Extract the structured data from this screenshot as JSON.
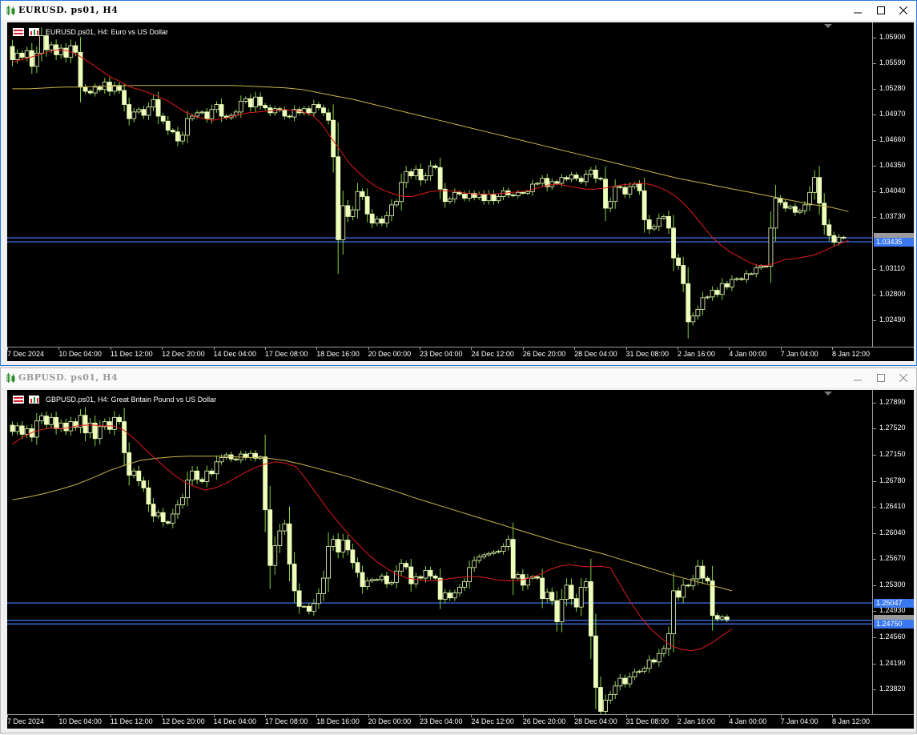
{
  "windows": [
    {
      "id": "eurusd",
      "title": "EURUSD. ps01, H4",
      "chart_label": "EURUSD.ps01, H4:  Euro vs US Dollar",
      "price_labels": [
        "1.05900",
        "1.05590",
        "1.05280",
        "1.04970",
        "1.04660",
        "1.04350",
        "1.04040",
        "1.03730",
        "1.03110",
        "1.02800",
        "1.02490"
      ],
      "price_values": [
        1.059,
        1.0559,
        1.0528,
        1.0497,
        1.0466,
        1.0435,
        1.0404,
        1.0373,
        1.0311,
        1.028,
        1.0249
      ],
      "y_range": [
        1.0217,
        1.0608
      ],
      "hlines": [
        1.03482,
        1.03435
      ],
      "badges": [
        {
          "text": "1.03435",
          "value": 1.03435
        }
      ],
      "time_labels": [
        "7 Dec 2024",
        "10 Dec 04:00",
        "11 Dec 12:00",
        "12 Dec 20:00",
        "14 Dec 04:00",
        "17 Dec 08:00",
        "18 Dec 16:00",
        "20 Dec 00:00",
        "23 Dec 04:00",
        "24 Dec 12:00",
        "26 Dec 20:00",
        "28 Dec 04:00",
        "31 Dec 08:00",
        "2 Jan 16:00",
        "4 Jan 00:00",
        "7 Jan 04:00",
        "8 Jan 12:00"
      ],
      "series": [
        1.0579,
        1.0563,
        1.0571,
        1.0566,
        1.0574,
        1.0555,
        1.0571,
        1.0592,
        1.0575,
        1.0581,
        1.0569,
        1.0577,
        1.0566,
        1.058,
        1.0572,
        1.053,
        1.0525,
        1.0523,
        1.053,
        1.0527,
        1.0536,
        1.0525,
        1.0532,
        1.0526,
        1.0509,
        1.0492,
        1.05,
        1.0503,
        1.0496,
        1.0506,
        1.0515,
        1.0495,
        1.0489,
        1.0478,
        1.0476,
        1.0465,
        1.0472,
        1.0492,
        1.0495,
        1.0499,
        1.05,
        1.0492,
        1.0503,
        1.0509,
        1.0495,
        1.0493,
        1.0496,
        1.05,
        1.0513,
        1.0516,
        1.0506,
        1.0518,
        1.0508,
        1.0505,
        1.0499,
        1.0504,
        1.0502,
        1.0495,
        1.0494,
        1.0503,
        1.0499,
        1.0504,
        1.0499,
        1.0509,
        1.0505,
        1.0499,
        1.049,
        1.0446,
        1.0346,
        1.0387,
        1.0374,
        1.0382,
        1.0404,
        1.0398,
        1.0377,
        1.0366,
        1.0371,
        1.0366,
        1.0375,
        1.0388,
        1.0392,
        1.0415,
        1.0428,
        1.0423,
        1.0431,
        1.0418,
        1.0423,
        1.0435,
        1.0433,
        1.0407,
        1.0392,
        1.0395,
        1.0403,
        1.0401,
        1.0396,
        1.0402,
        1.0397,
        1.0401,
        1.0393,
        1.0401,
        1.0393,
        1.0398,
        1.0405,
        1.04,
        1.0399,
        1.0403,
        1.0402,
        1.0404,
        1.0413,
        1.0414,
        1.042,
        1.041,
        1.0416,
        1.0414,
        1.0421,
        1.0419,
        1.0424,
        1.042,
        1.0416,
        1.0425,
        1.043,
        1.042,
        1.0419,
        1.0384,
        1.0392,
        1.041,
        1.0409,
        1.0401,
        1.041,
        1.0413,
        1.0405,
        1.037,
        1.0359,
        1.0362,
        1.0372,
        1.0374,
        1.036,
        1.0324,
        1.0315,
        1.0293,
        1.0247,
        1.0254,
        1.0262,
        1.0276,
        1.0277,
        1.0285,
        1.028,
        1.0293,
        1.0289,
        1.0298,
        1.0299,
        1.0298,
        1.0305,
        1.0305,
        1.0312,
        1.0314,
        1.0314,
        1.036,
        1.0396,
        1.0391,
        1.0384,
        1.0386,
        1.0379,
        1.0381,
        1.0388,
        1.0403,
        1.0421,
        1.039,
        1.0364,
        1.0351,
        1.0343,
        1.0349,
        1.0348
      ],
      "ma_fast": [
        1.056,
        1.0563,
        1.0566,
        1.0569,
        1.0573,
        1.0575,
        1.0574,
        1.057,
        1.0563,
        1.0556,
        1.0548,
        1.0541,
        1.0536,
        1.053,
        1.0527,
        1.0523,
        1.0519,
        1.0514,
        1.0507,
        1.05,
        1.0495,
        1.0492,
        1.049,
        1.0492,
        1.0494,
        1.0497,
        1.0499,
        1.05,
        1.0501,
        1.0502,
        1.0503,
        1.0502,
        1.05,
        1.0496,
        1.0486,
        1.047,
        1.0455,
        1.0439,
        1.0428,
        1.0418,
        1.041,
        1.0405,
        1.0401,
        1.0398,
        1.0398,
        1.0401,
        1.0404,
        1.0405,
        1.0405,
        1.0404,
        1.0402,
        1.0401,
        1.0401,
        1.0401,
        1.0402,
        1.0403,
        1.0404,
        1.0406,
        1.0409,
        1.0412,
        1.0413,
        1.0411,
        1.0409,
        1.0407,
        1.0407,
        1.0408,
        1.041,
        1.0412,
        1.0413,
        1.0414,
        1.0413,
        1.041,
        1.0405,
        1.0398,
        1.0388,
        1.0376,
        1.0362,
        1.0349,
        1.0339,
        1.0331,
        1.0325,
        1.0319,
        1.0315,
        1.0315,
        1.0318,
        1.0322,
        1.0323,
        1.0325,
        1.0327,
        1.0331,
        1.0336,
        1.0341,
        1.0345
      ],
      "ma_slow": [
        1.0528,
        1.0528,
        1.0529,
        1.053,
        1.053,
        1.0531,
        1.0531,
        1.0532,
        1.0532,
        1.0532,
        1.0532,
        1.0532,
        1.0532,
        1.0532,
        1.0531,
        1.053,
        1.0529,
        1.0527,
        1.0523,
        1.0519,
        1.0515,
        1.051,
        1.0505,
        1.05,
        1.0495,
        1.049,
        1.0485,
        1.048,
        1.0475,
        1.047,
        1.0465,
        1.046,
        1.0455,
        1.045,
        1.0445,
        1.044,
        1.0435,
        1.043,
        1.0425,
        1.042,
        1.0416,
        1.0412,
        1.0408,
        1.0404,
        1.04,
        1.0396,
        1.0392,
        1.0388,
        1.0385,
        1.038
      ],
      "ma_slow_end": 1.038
    },
    {
      "id": "gbpusd",
      "title": "GBPUSD. ps01, H4",
      "chart_label": "GBPUSD.ps01, H4:  Great Britain Pound vs US Dollar",
      "price_labels": [
        "1.27890",
        "1.27520",
        "1.27150",
        "1.26780",
        "1.26410",
        "1.26040",
        "1.25670",
        "1.25300",
        "1.24930",
        "1.24560",
        "1.24190",
        "1.23820"
      ],
      "price_values": [
        1.2789,
        1.2752,
        1.2715,
        1.2678,
        1.2641,
        1.2604,
        1.2567,
        1.253,
        1.2493,
        1.2456,
        1.2419,
        1.2382
      ],
      "y_range": [
        1.2347,
        1.2807
      ],
      "hlines": [
        1.25047,
        1.248,
        1.2475
      ],
      "badges": [
        {
          "text": "1.25047",
          "value": 1.25047
        },
        {
          "text": "1.24750",
          "value": 1.2475
        }
      ],
      "time_labels": [
        "7 Dec 2024",
        "10 Dec 04:00",
        "11 Dec 12:00",
        "12 Dec 20:00",
        "14 Dec 04:00",
        "17 Dec 08:00",
        "18 Dec 16:00",
        "20 Dec 00:00",
        "23 Dec 04:00",
        "24 Dec 12:00",
        "26 Dec 20:00",
        "28 Dec 04:00",
        "31 Dec 08:00",
        "2 Jan 16:00",
        "4 Jan 00:00",
        "7 Jan 04:00",
        "8 Jan 12:00"
      ],
      "series": [
        1.2757,
        1.2748,
        1.2756,
        1.2744,
        1.2752,
        1.274,
        1.2763,
        1.277,
        1.2758,
        1.2768,
        1.2752,
        1.276,
        1.2749,
        1.2762,
        1.2754,
        1.2771,
        1.2746,
        1.276,
        1.2738,
        1.2755,
        1.2762,
        1.2751,
        1.2768,
        1.2762,
        1.2718,
        1.2686,
        1.2692,
        1.2678,
        1.2668,
        1.2645,
        1.2628,
        1.2633,
        1.262,
        1.2618,
        1.2631,
        1.2644,
        1.2654,
        1.2679,
        1.2692,
        1.268,
        1.2677,
        1.2692,
        1.2688,
        1.2705,
        1.2711,
        1.2715,
        1.2709,
        1.2708,
        1.2716,
        1.2711,
        1.2717,
        1.271,
        1.2712,
        1.2637,
        1.2558,
        1.2586,
        1.2607,
        1.2617,
        1.256,
        1.2522,
        1.25,
        1.25,
        1.2493,
        1.2504,
        1.2518,
        1.254,
        1.2585,
        1.2595,
        1.2577,
        1.2594,
        1.258,
        1.2562,
        1.2548,
        1.2528,
        1.2536,
        1.2538,
        1.2538,
        1.2543,
        1.2532,
        1.2534,
        1.255,
        1.2561,
        1.2556,
        1.2532,
        1.2542,
        1.254,
        1.2551,
        1.2543,
        1.254,
        1.251,
        1.2519,
        1.2512,
        1.2519,
        1.2527,
        1.2535,
        1.2555,
        1.2565,
        1.257,
        1.2573,
        1.2575,
        1.2577,
        1.2578,
        1.2585,
        1.2595,
        1.254,
        1.2545,
        1.253,
        1.254,
        1.2542,
        1.254,
        1.2511,
        1.252,
        1.2508,
        1.2478,
        1.251,
        1.253,
        1.2511,
        1.2499,
        1.2527,
        1.2535,
        1.2458,
        1.2385,
        1.2351,
        1.2367,
        1.2375,
        1.2387,
        1.2398,
        1.239,
        1.24,
        1.2407,
        1.2408,
        1.2412,
        1.2424,
        1.2421,
        1.2433,
        1.244,
        1.2461,
        1.2522,
        1.2513,
        1.253,
        1.2529,
        1.2539,
        1.2557,
        1.254,
        1.2536,
        1.2487,
        1.2482,
        1.2485,
        1.2481
      ],
      "ma_fast": [
        1.273,
        1.274,
        1.2747,
        1.2751,
        1.2753,
        1.2752,
        1.2755,
        1.2757,
        1.2757,
        1.2756,
        1.2756,
        1.275,
        1.2738,
        1.2724,
        1.2711,
        1.2698,
        1.2686,
        1.2676,
        1.267,
        1.2665,
        1.2668,
        1.2674,
        1.2682,
        1.269,
        1.2697,
        1.2702,
        1.2705,
        1.2703,
        1.2698,
        1.268,
        1.266,
        1.264,
        1.2622,
        1.2605,
        1.259,
        1.2575,
        1.2563,
        1.2553,
        1.2545,
        1.254,
        1.2538,
        1.2536,
        1.2537,
        1.2539,
        1.2541,
        1.2542,
        1.2542,
        1.254,
        1.2537,
        1.2536,
        1.2537,
        1.254,
        1.2545,
        1.2552,
        1.2557,
        1.2559,
        1.2557,
        1.2556,
        1.2557,
        1.2555,
        1.253,
        1.2506,
        1.2485,
        1.2468,
        1.2455,
        1.2444,
        1.2439,
        1.2437,
        1.244,
        1.2448,
        1.2458,
        1.2468
      ],
      "ma_slow": [
        1.2651,
        1.2655,
        1.266,
        1.2666,
        1.2673,
        1.2682,
        1.2692,
        1.27,
        1.2707,
        1.271,
        1.2712,
        1.2713,
        1.2713,
        1.2713,
        1.2712,
        1.2711,
        1.271,
        1.2707,
        1.2702,
        1.2696,
        1.269,
        1.2684,
        1.2677,
        1.267,
        1.2663,
        1.2655,
        1.2648,
        1.2641,
        1.2634,
        1.2627,
        1.262,
        1.2613,
        1.2606,
        1.2599,
        1.2592,
        1.2586,
        1.258,
        1.2574,
        1.2567,
        1.256,
        1.2553,
        1.2546,
        1.254,
        1.2534,
        1.2528,
        1.2522
      ],
      "ma_slow_end": 1.252
    }
  ],
  "colors": {
    "candle": "#eeffbb",
    "wick": "#7fd13d",
    "ma_fast": "#e01b1b",
    "ma_slow": "#c9b34a",
    "hline": "#3f6fe8",
    "badge": "#3a78f0"
  }
}
